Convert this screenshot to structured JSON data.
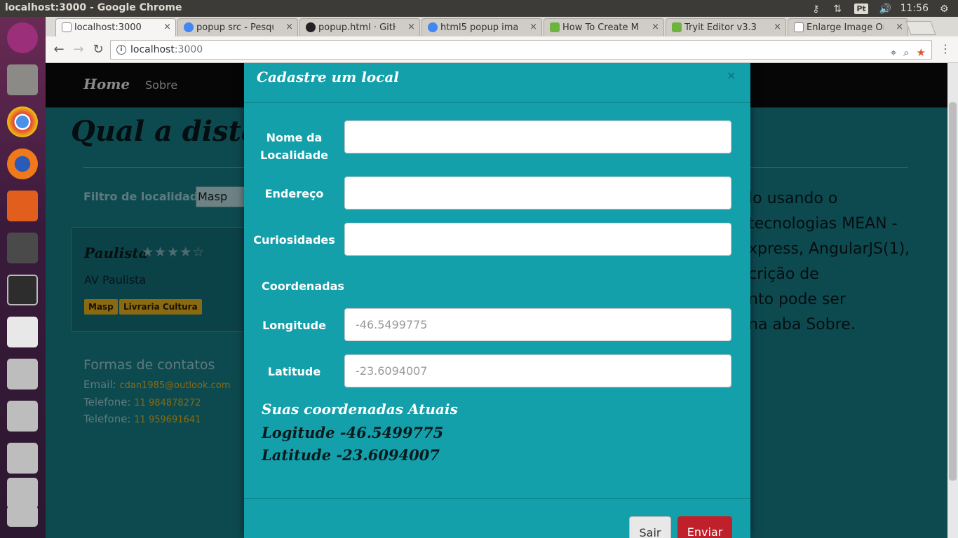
{
  "os": {
    "window_title": "localhost:3000 - Google Chrome",
    "lang": "Pt",
    "clock": "11:56"
  },
  "tabs": [
    {
      "label": "localhost:3000",
      "favicon": "page-icon"
    },
    {
      "label": "popup src - Pesqui",
      "favicon": "google-icon"
    },
    {
      "label": "popup.html · GitH",
      "favicon": "github-icon"
    },
    {
      "label": "html5 popup ima",
      "favicon": "google-icon"
    },
    {
      "label": "How To Create M",
      "favicon": "w3schools-icon"
    },
    {
      "label": "Tryit Editor v3.3",
      "favicon": "w3schools-icon"
    },
    {
      "label": "Enlarge Image On",
      "favicon": "page-icon"
    }
  ],
  "address_bar": {
    "host": "localhost",
    "port": ":3000"
  },
  "page": {
    "nav_home": "Home",
    "nav_sobre": "Sobre",
    "heading": "Qual a distância",
    "filter_label": "Filtro de localidades",
    "filter_value": "Masp",
    "place": {
      "name": "Paulista",
      "stars": "★★★★☆",
      "rating": 4,
      "address": "AV Paulista",
      "tags": [
        "Masp",
        "Livraria Cultura"
      ]
    },
    "contacts": {
      "title": "Formas de contatos",
      "email_label": "Email:",
      "email": "cdan1985@outlook.com",
      "phone_label": "Telefone:",
      "phone1": "11 984878272",
      "phone2": "11 959691641"
    },
    "about_lines": [
      "lo usando o",
      "tecnologias MEAN -",
      "xpress, AngularJS(1),",
      "crição de",
      "nto pode ser",
      "na aba Sobre."
    ]
  },
  "modal": {
    "title": "Cadastre um local",
    "close": "×",
    "labels": {
      "name_line1": "Nome da",
      "name_line2": "Localidade",
      "address": "Endereço",
      "curiosities": "Curiosidades",
      "coordinates": "Coordenadas",
      "longitude": "Longitude",
      "latitude": "Latitude"
    },
    "fields": {
      "name_value": "",
      "address_value": "",
      "curiosities_value": "",
      "longitude_value": "-46.5499775",
      "latitude_value": "-23.6094007"
    },
    "current": {
      "title": "Suas coordenadas Atuais",
      "longitude_line": "Logitude -46.5499775",
      "latitude_line": "Latitude -23.6094007"
    },
    "buttons": {
      "exit": "Sair",
      "send": "Enviar"
    }
  },
  "colors": {
    "modal_bg": "#14a0ab",
    "send_button": "#c0202a",
    "tag_bg": "#8a6a10"
  }
}
